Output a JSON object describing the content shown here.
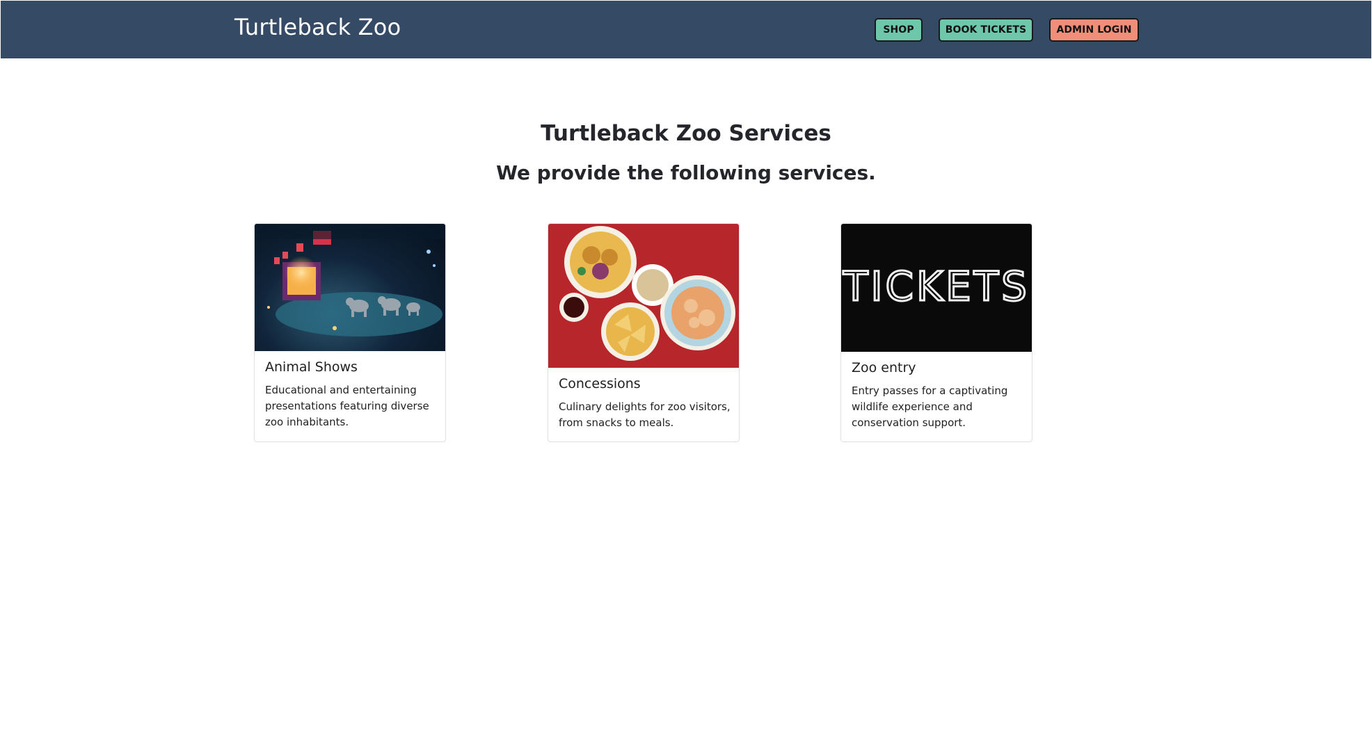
{
  "header": {
    "brand": "Turtleback Zoo",
    "buttons": {
      "shop": "SHOP",
      "book_tickets": "BOOK TICKETS",
      "admin_login": "ADMIN LOGIN"
    }
  },
  "main": {
    "title": "Turtleback Zoo Services",
    "subtitle": "We provide the following services."
  },
  "cards": [
    {
      "title": "Animal Shows",
      "text": "Educational and entertaining presentations featuring diverse zoo inhabitants.",
      "image_icon": "circus-elephants-photo"
    },
    {
      "title": "Concessions",
      "text": "Culinary delights for zoo visitors, from snacks to meals.",
      "image_icon": "food-plates-photo"
    },
    {
      "title": "Zoo entry",
      "text": "Entry passes for a captivating wildlife experience and conservation support.",
      "image_icon": "tickets-neon-sign-photo",
      "image_lettering": "TICKETS"
    }
  ],
  "colors": {
    "navbar": "#344a65",
    "shop_button": "#6fc7ab",
    "admin_button": "#f08e7a"
  }
}
